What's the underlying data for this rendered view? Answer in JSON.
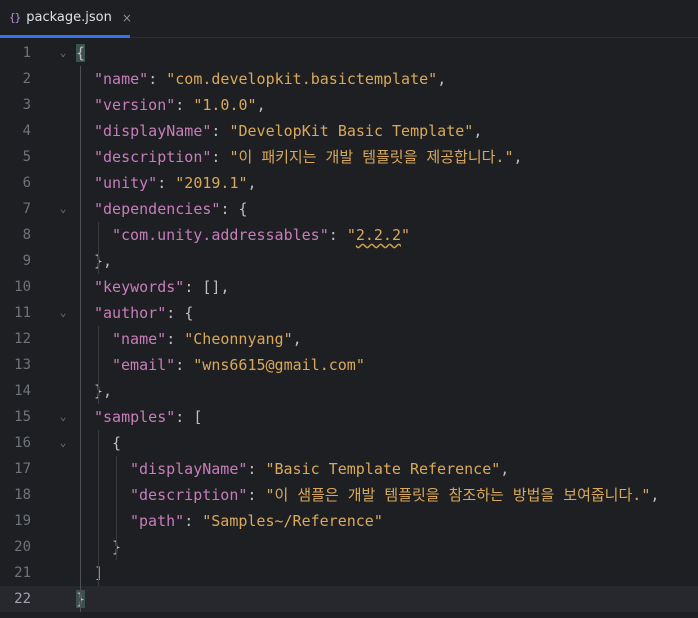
{
  "tab": {
    "icon": "json-braces-icon",
    "icon_glyph": "{}",
    "title": "package.json",
    "close_glyph": "×"
  },
  "editor": {
    "current_line": 22,
    "lines": [
      {
        "n": "1",
        "indent": 0,
        "fold": "⌄",
        "tokens": [
          {
            "t": "{",
            "c": "bh"
          }
        ]
      },
      {
        "n": "2",
        "indent": 1,
        "fold": "",
        "tokens": [
          {
            "t": "\"name\"",
            "c": "k"
          },
          {
            "t": ": ",
            "c": "p"
          },
          {
            "t": "\"com.developkit.basictemplate\"",
            "c": "s"
          },
          {
            "t": ",",
            "c": "p"
          }
        ]
      },
      {
        "n": "3",
        "indent": 1,
        "fold": "",
        "tokens": [
          {
            "t": "\"version\"",
            "c": "k"
          },
          {
            "t": ": ",
            "c": "p"
          },
          {
            "t": "\"1.0.0\"",
            "c": "s"
          },
          {
            "t": ",",
            "c": "p"
          }
        ]
      },
      {
        "n": "4",
        "indent": 1,
        "fold": "",
        "tokens": [
          {
            "t": "\"displayName\"",
            "c": "k"
          },
          {
            "t": ": ",
            "c": "p"
          },
          {
            "t": "\"DevelopKit Basic Template\"",
            "c": "s"
          },
          {
            "t": ",",
            "c": "p"
          }
        ]
      },
      {
        "n": "5",
        "indent": 1,
        "fold": "",
        "tokens": [
          {
            "t": "\"description\"",
            "c": "k"
          },
          {
            "t": ": ",
            "c": "p"
          },
          {
            "t": "\"이 패키지는 개발 템플릿을 제공합니다.\"",
            "c": "s"
          },
          {
            "t": ",",
            "c": "p"
          }
        ]
      },
      {
        "n": "6",
        "indent": 1,
        "fold": "",
        "tokens": [
          {
            "t": "\"unity\"",
            "c": "k"
          },
          {
            "t": ": ",
            "c": "p"
          },
          {
            "t": "\"2019.1\"",
            "c": "s"
          },
          {
            "t": ",",
            "c": "p"
          }
        ]
      },
      {
        "n": "7",
        "indent": 1,
        "fold": "⌄",
        "tokens": [
          {
            "t": "\"dependencies\"",
            "c": "k"
          },
          {
            "t": ": ",
            "c": "p"
          },
          {
            "t": "{",
            "c": "b"
          }
        ]
      },
      {
        "n": "8",
        "indent": 2,
        "fold": "",
        "tokens": [
          {
            "t": "\"com.unity.addressables\"",
            "c": "k"
          },
          {
            "t": ": ",
            "c": "p"
          },
          {
            "t": "\"",
            "c": "s"
          },
          {
            "t": "2.2.2",
            "c": "s typo"
          },
          {
            "t": "\"",
            "c": "s"
          }
        ]
      },
      {
        "n": "9",
        "indent": 1,
        "fold": "",
        "tokens": [
          {
            "t": "}",
            "c": "b"
          },
          {
            "t": ",",
            "c": "p"
          }
        ]
      },
      {
        "n": "10",
        "indent": 1,
        "fold": "",
        "tokens": [
          {
            "t": "\"keywords\"",
            "c": "k"
          },
          {
            "t": ": ",
            "c": "p"
          },
          {
            "t": "[]",
            "c": "b"
          },
          {
            "t": ",",
            "c": "p"
          }
        ]
      },
      {
        "n": "11",
        "indent": 1,
        "fold": "⌄",
        "tokens": [
          {
            "t": "\"author\"",
            "c": "k"
          },
          {
            "t": ": ",
            "c": "p"
          },
          {
            "t": "{",
            "c": "b"
          }
        ]
      },
      {
        "n": "12",
        "indent": 2,
        "fold": "",
        "tokens": [
          {
            "t": "\"name\"",
            "c": "k"
          },
          {
            "t": ": ",
            "c": "p"
          },
          {
            "t": "\"Cheonnyang\"",
            "c": "s"
          },
          {
            "t": ",",
            "c": "p"
          }
        ]
      },
      {
        "n": "13",
        "indent": 2,
        "fold": "",
        "tokens": [
          {
            "t": "\"email\"",
            "c": "k"
          },
          {
            "t": ": ",
            "c": "p"
          },
          {
            "t": "\"wns6615@gmail.com\"",
            "c": "s"
          }
        ]
      },
      {
        "n": "14",
        "indent": 1,
        "fold": "",
        "tokens": [
          {
            "t": "}",
            "c": "b"
          },
          {
            "t": ",",
            "c": "p"
          }
        ]
      },
      {
        "n": "15",
        "indent": 1,
        "fold": "⌄",
        "tokens": [
          {
            "t": "\"samples\"",
            "c": "k"
          },
          {
            "t": ": ",
            "c": "p"
          },
          {
            "t": "[",
            "c": "b"
          }
        ]
      },
      {
        "n": "16",
        "indent": 2,
        "fold": "⌄",
        "tokens": [
          {
            "t": "{",
            "c": "b"
          }
        ]
      },
      {
        "n": "17",
        "indent": 3,
        "fold": "",
        "tokens": [
          {
            "t": "\"displayName\"",
            "c": "k"
          },
          {
            "t": ": ",
            "c": "p"
          },
          {
            "t": "\"Basic Template Reference\"",
            "c": "s"
          },
          {
            "t": ",",
            "c": "p"
          }
        ]
      },
      {
        "n": "18",
        "indent": 3,
        "fold": "",
        "tokens": [
          {
            "t": "\"description\"",
            "c": "k"
          },
          {
            "t": ": ",
            "c": "p"
          },
          {
            "t": "\"이 샘플은 개발 템플릿을 참조하는 방법을 보여줍니다.\"",
            "c": "s"
          },
          {
            "t": ",",
            "c": "p"
          }
        ]
      },
      {
        "n": "19",
        "indent": 3,
        "fold": "",
        "tokens": [
          {
            "t": "\"path\"",
            "c": "k"
          },
          {
            "t": ": ",
            "c": "p"
          },
          {
            "t": "\"Samples~/Reference\"",
            "c": "s"
          }
        ]
      },
      {
        "n": "20",
        "indent": 2,
        "fold": "",
        "tokens": [
          {
            "t": "}",
            "c": "b"
          }
        ]
      },
      {
        "n": "21",
        "indent": 1,
        "fold": "",
        "tokens": [
          {
            "t": "]",
            "c": "b"
          }
        ]
      },
      {
        "n": "22",
        "indent": 0,
        "fold": "",
        "tokens": [
          {
            "t": "}",
            "c": "bh"
          }
        ]
      }
    ]
  },
  "colors": {
    "background": "#1e1f22",
    "key": "#c77dbb",
    "string": "#d9a95b",
    "punctuation": "#bcbec4",
    "line_number": "#6f737a",
    "tab_underline": "#3574f0",
    "matched_brace_bg": "#3b514d"
  }
}
